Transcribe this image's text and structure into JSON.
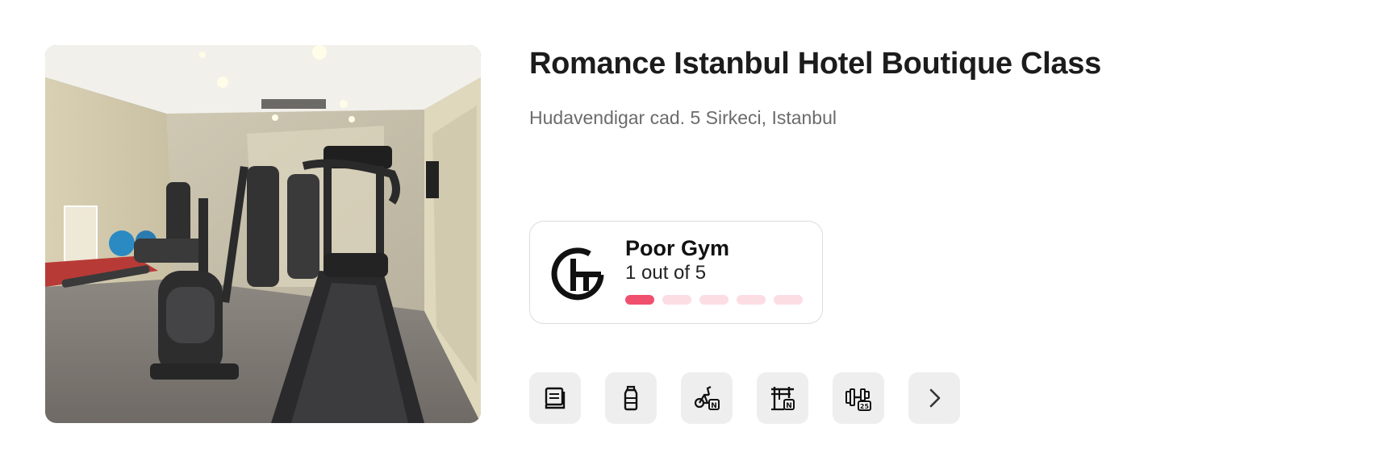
{
  "hotel": {
    "name": "Romance Istanbul Hotel Boutique Class",
    "address": "Hudavendigar cad. 5 Sirkeci, Istanbul",
    "photo_icon": "gym-photo"
  },
  "gym_rating": {
    "label": "Poor Gym",
    "score_text": "1 out of 5",
    "score": 1,
    "max": 5,
    "logo_icon": "gym-rating-logo-icon",
    "colors": {
      "active": "#f0506e",
      "inactive": "#fcdde3"
    }
  },
  "amenities": [
    {
      "icon": "towel-icon"
    },
    {
      "icon": "water-bottle-icon"
    },
    {
      "icon": "exercise-bike-icon"
    },
    {
      "icon": "power-rack-icon"
    },
    {
      "icon": "dumbbells-icon"
    },
    {
      "icon": "chevron-right-icon"
    }
  ]
}
